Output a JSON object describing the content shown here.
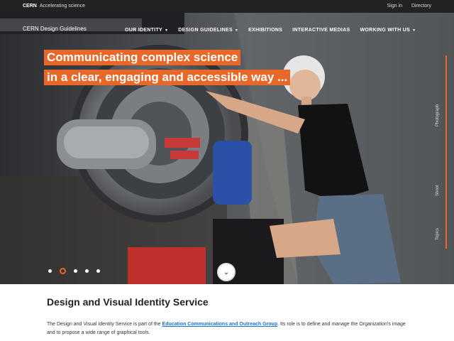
{
  "topbar": {
    "brand": "CERN",
    "tagline": "Accelerating science",
    "links": [
      "Sign in",
      "Directory"
    ]
  },
  "header": {
    "site_title": "CERN Design Guidelines",
    "nav": [
      {
        "label": "OUR IDENTITY",
        "dropdown": true
      },
      {
        "label": "DESIGN GUIDELINES",
        "dropdown": true
      },
      {
        "label": "EXHIBITIONS",
        "dropdown": false
      },
      {
        "label": "INTERACTIVE MEDIAS",
        "dropdown": false
      },
      {
        "label": "WORKING WITH US",
        "dropdown": true
      }
    ]
  },
  "hero": {
    "headline_line1": "Communicating complex science",
    "headline_line2": "in a clear, engaging and accessible way ...",
    "side_labels": [
      "Topics",
      "Shoot",
      "Photograph"
    ],
    "slider_total": 5,
    "slider_active_index": 1
  },
  "main": {
    "title": "Design and Visual Identity Service",
    "intro_before": "The Design and Visual Identity Service is part of the",
    "intro_link": "Education Communications and Outreach Group",
    "intro_after": ". Its role is to define and manage the Organization's image and to propose a wide range of graphical tools."
  },
  "colors": {
    "accent": "#e8682a",
    "topbar": "#222222",
    "link": "#1a73c8"
  }
}
